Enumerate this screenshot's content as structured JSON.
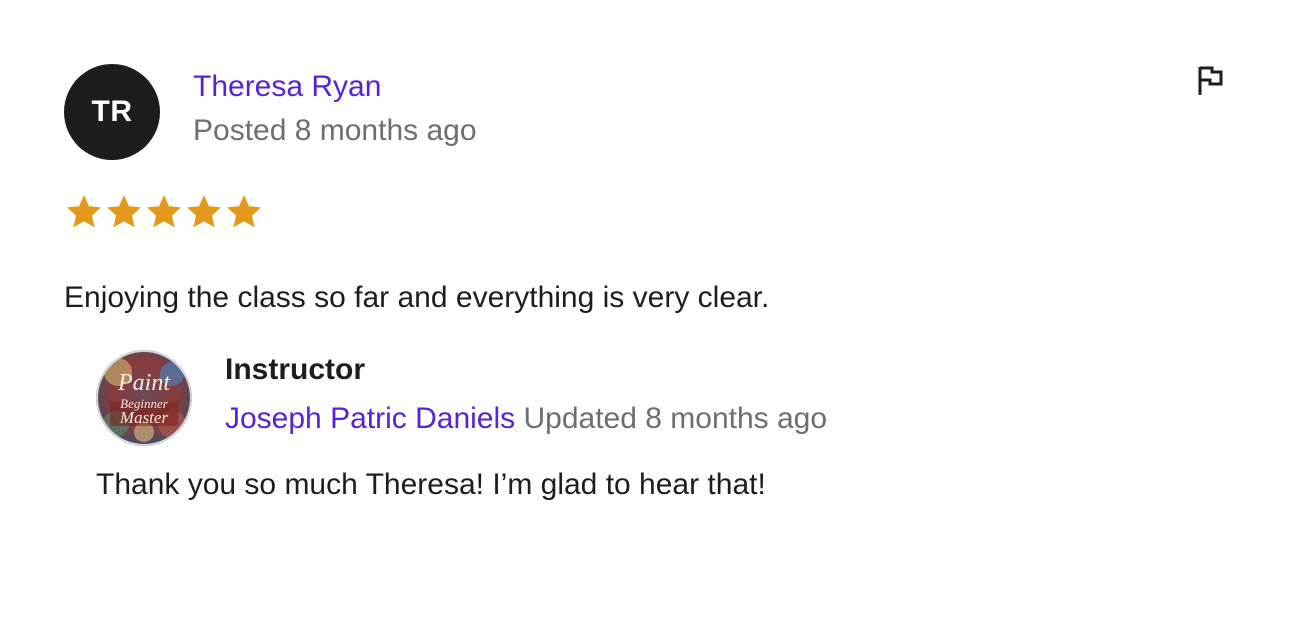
{
  "review": {
    "avatar_initials": "TR",
    "reviewer_name": "Theresa Ryan",
    "posted": "Posted 8 months ago",
    "rating": 5,
    "rating_max": 5,
    "star_color": "#e59819",
    "text": "Enjoying the class so far and everything is very clear.",
    "report_icon": "flag-icon"
  },
  "reply": {
    "role": "Instructor",
    "instructor_name": "Joseph Patric Daniels",
    "updated": "Updated 8 months ago",
    "text": "Thank you so much Theresa! I’m glad to hear that!",
    "avatar_logo": {
      "line1": "Paint",
      "line2": "Beginner",
      "line3": "Master"
    }
  },
  "colors": {
    "link": "#5624d0",
    "muted": "#6a6f73",
    "text": "#1c1d1f"
  }
}
